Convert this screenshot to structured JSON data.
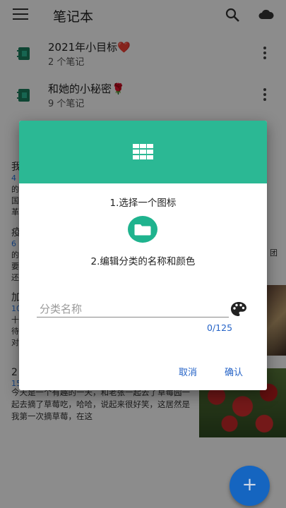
{
  "appbar": {
    "title": "笔记本"
  },
  "notebooks": [
    {
      "title": "2021年小目标❤️",
      "count": "2 个笔记"
    },
    {
      "title": "和她的小秘密🌹",
      "count": "9 个笔记"
    }
  ],
  "notes": [
    {
      "title": "我",
      "date": "4"
    },
    {
      "title": "疫",
      "date": "6"
    },
    {
      "title": "加",
      "date": "10"
    },
    {
      "title": "2",
      "date": "15"
    }
  ],
  "note_excerpts": [
    "的",
    "国",
    "革",
    "的",
    "要",
    "还",
    "十",
    "待",
    "对"
  ],
  "note_excerpt_right": "团",
  "last_note_text": "今天是一个有趣的一天，和老张一起去了草莓园一起去摘了草莓吃，哈哈，说起来很好笑，这居然是我第一次摘草莓，在这",
  "dialog": {
    "step1": "1.选择一个图标",
    "step2": "2.编辑分类的名称和颜色",
    "name_placeholder": "分类名称",
    "name_value": "",
    "counter": "0/125",
    "cancel": "取消",
    "confirm": "确认"
  },
  "fab": {
    "label": "+"
  },
  "colors": {
    "dialog_header": "#2bb894",
    "accent": "#2563c7",
    "fab": "#1565c0"
  }
}
